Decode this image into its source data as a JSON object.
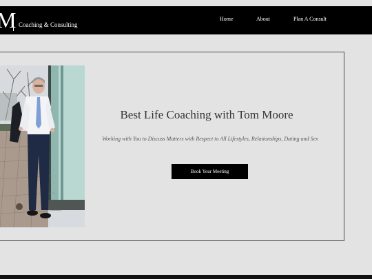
{
  "brand": {
    "mark": "M",
    "tagline": "Coaching & Consulting"
  },
  "nav": {
    "home": "Home",
    "about": "About",
    "plan": "Plan A Consult"
  },
  "hero": {
    "title": "Best Life Coaching with Tom Moore",
    "subtitle": "Working with You to Discuss Matters with Respect to All Lifestyles, Relationships, Dating and Sex",
    "cta": "Book Your Meeting"
  },
  "colors": {
    "background": "#e3e3e3",
    "navbar": "#000000",
    "button": "#000000"
  }
}
